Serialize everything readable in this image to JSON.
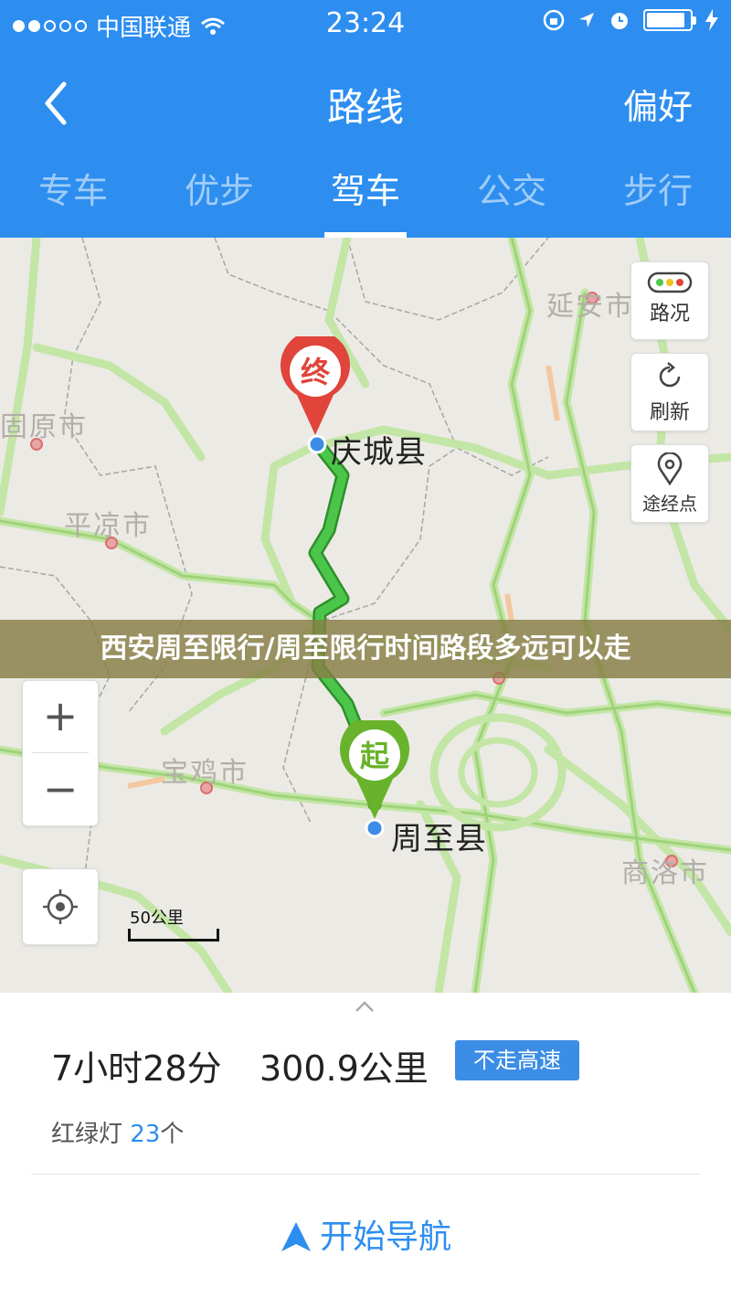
{
  "status": {
    "carrier": "中国联通",
    "time": "23:24",
    "battery_level": 0.9
  },
  "header": {
    "back_icon": "chevron-left-icon",
    "title": "路线",
    "pref": "偏好"
  },
  "tabs": [
    {
      "label": "专车"
    },
    {
      "label": "优步"
    },
    {
      "label": "驾车",
      "active": true
    },
    {
      "label": "公交"
    },
    {
      "label": "步行"
    }
  ],
  "map": {
    "cities": {
      "yanan": "延安市",
      "guyuan": "固原市",
      "pingliang": "平凉市",
      "baoji": "宝鸡市",
      "shangluo": "商洛市"
    },
    "start_place": "周至县",
    "end_place": "庆城县",
    "start_marker": "起",
    "end_marker": "终",
    "controls": {
      "traffic": "路况",
      "refresh": "刷新",
      "waypoint": "途经点"
    },
    "zoom_in": "+",
    "zoom_out": "−",
    "scale": "50公里"
  },
  "banner": "西安周至限行/周至限行时间路段多远可以走",
  "summary": {
    "duration": "7小时28分",
    "distance": "300.9公里",
    "badge": "不走高速",
    "lights_label": "红绿灯",
    "lights_count": "23",
    "lights_unit": "个",
    "navigate": "开始导航"
  },
  "colors": {
    "primary": "#2d8ef0",
    "route": "#3cb93c",
    "start": "#69b22b",
    "end": "#e0443a"
  }
}
